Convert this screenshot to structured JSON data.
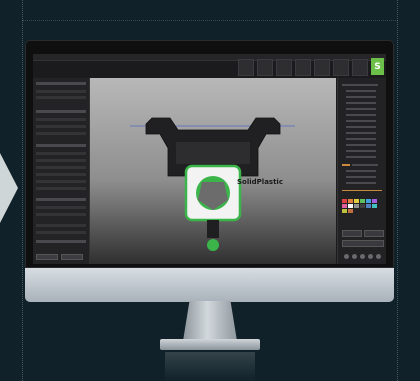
{
  "app": {
    "title": "",
    "part_label": "SolidPlastic",
    "accent_tool_glyph": "S"
  },
  "toolbar": {
    "tools": [
      "",
      "",
      "",
      "",
      "",
      "",
      ""
    ]
  },
  "colors": {
    "background": "#102129",
    "accent": "#6cc04a",
    "selection": "#c98b3b",
    "part_body": "#202022",
    "part_green": "#3bb54a"
  },
  "palette": [
    "#e04040",
    "#e08040",
    "#e0d040",
    "#60c060",
    "#40a0e0",
    "#a060e0",
    "#e060a0",
    "#ffffff",
    "#909090",
    "#404040",
    "#5080c0",
    "#40c0c0",
    "#c0c040",
    "#c07040"
  ],
  "icons": [
    "monitor-icon",
    "toolbar-icons",
    "arrow-icon"
  ]
}
